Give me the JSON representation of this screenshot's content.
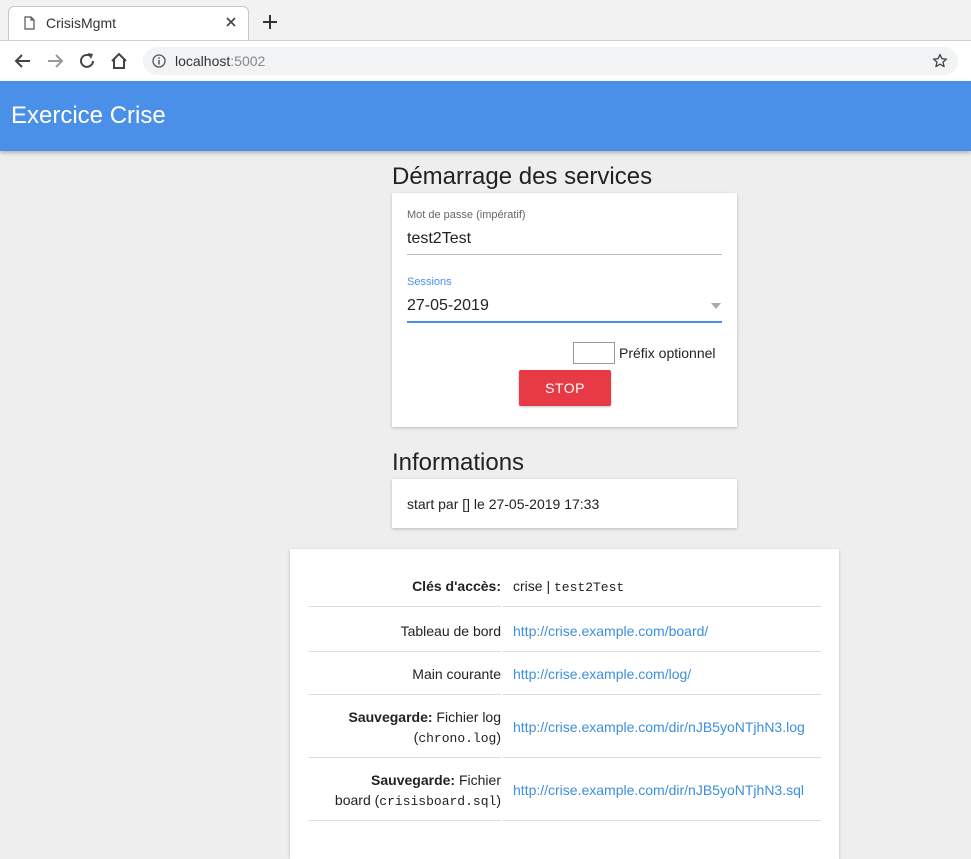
{
  "browser": {
    "tab_title": "CrisisMgmt",
    "url_host": "localhost",
    "url_port": ":5002"
  },
  "app": {
    "title": "Exercice Crise"
  },
  "services": {
    "section_title": "Démarrage des services",
    "password_label": "Mot de passe (impératif)",
    "password_value": "test2Test",
    "sessions_label": "Sessions",
    "sessions_value": "27-05-2019",
    "prefix_label": "Préfix optionnel",
    "prefix_value": "",
    "stop_label": "STOP",
    "colors": {
      "accent": "#4a90e9",
      "stop": "#e83a44"
    }
  },
  "informations": {
    "section_title": "Informations",
    "text": "start par [] le 27-05-2019 17:33"
  },
  "access": {
    "rows": [
      {
        "label_bold": "Clés d'accès:",
        "value_user": "crise",
        "value_sep": " | ",
        "value_pass": "test2Test"
      },
      {
        "label": "Tableau de bord",
        "value": "http://crise.example.com/board/"
      },
      {
        "label": "Main courante",
        "value": "http://crise.example.com/log/"
      },
      {
        "label_bold": "Sauvegarde:",
        "label_rest": " Fichier log",
        "label_code": "chrono.log",
        "value": "http://crise.example.com/dir/nJB5yoNTjhN3.log"
      },
      {
        "label_bold": "Sauvegarde:",
        "label_rest": " Fichier",
        "label_prefix": "board ",
        "label_code": "crisisboard.sql",
        "value": "http://crise.example.com/dir/nJB5yoNTjhN3.sql"
      }
    ]
  },
  "icons": [
    "document-icon",
    "close-icon",
    "plus-icon",
    "back-icon",
    "forward-icon",
    "reload-icon",
    "home-icon",
    "info-icon",
    "star-icon",
    "dropdown-caret-icon"
  ]
}
